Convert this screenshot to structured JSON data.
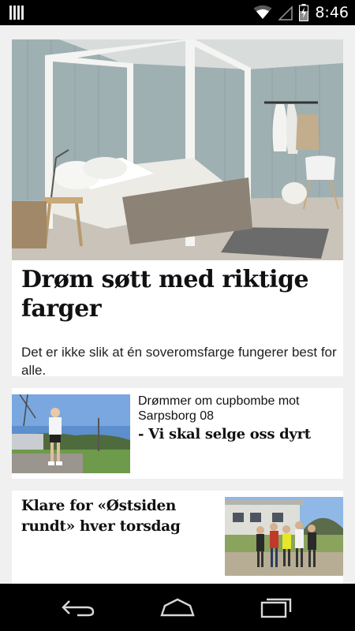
{
  "status_bar": {
    "time": "8:46",
    "icons": [
      "notification-icon",
      "wifi-icon",
      "signal-icon",
      "battery-charging-icon"
    ]
  },
  "feed": {
    "articles": [
      {
        "headline": "Drøm søtt med riktige farger",
        "teaser": "Det er ikke slik at én soveromsfarge fungerer best for alle.",
        "image": "bedroom-photo"
      },
      {
        "kicker": "Drømmer om cupbombe mot Sarpsborg 08",
        "headline": "- Vi skal selge oss dyrt",
        "image": "football-player-photo"
      },
      {
        "headline": "Klare for «Østsiden rundt» hver torsdag",
        "image": "runners-group-photo"
      }
    ]
  },
  "nav_bar": {
    "buttons": [
      "back-icon",
      "home-icon",
      "recent-apps-icon"
    ]
  },
  "colors": {
    "feed_background": "#f0f0f0",
    "card_background": "#ffffff",
    "system_bar": "#000000",
    "text": "#111111"
  }
}
